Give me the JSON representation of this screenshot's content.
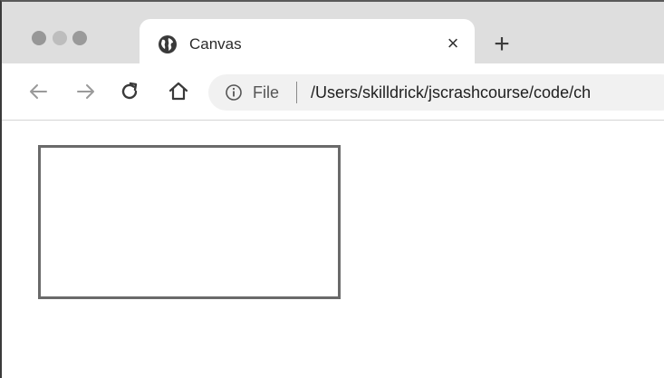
{
  "window": {
    "traffic_lights": [
      "close",
      "minimize",
      "maximize"
    ]
  },
  "tab": {
    "title": "Canvas",
    "favicon": "globe-icon",
    "close_label": "×"
  },
  "new_tab": {
    "label": "+"
  },
  "toolbar": {
    "back_icon": "arrow-left-icon",
    "forward_icon": "arrow-right-icon",
    "reload_icon": "reload-icon",
    "home_icon": "home-icon"
  },
  "omnibox": {
    "info_icon": "info-icon",
    "scheme_label": "File",
    "url": "/Users/skilldrick/jscrashcourse/code/ch"
  },
  "page": {
    "canvas": {
      "element": "canvas",
      "border_color": "#6a6a6a"
    }
  }
}
